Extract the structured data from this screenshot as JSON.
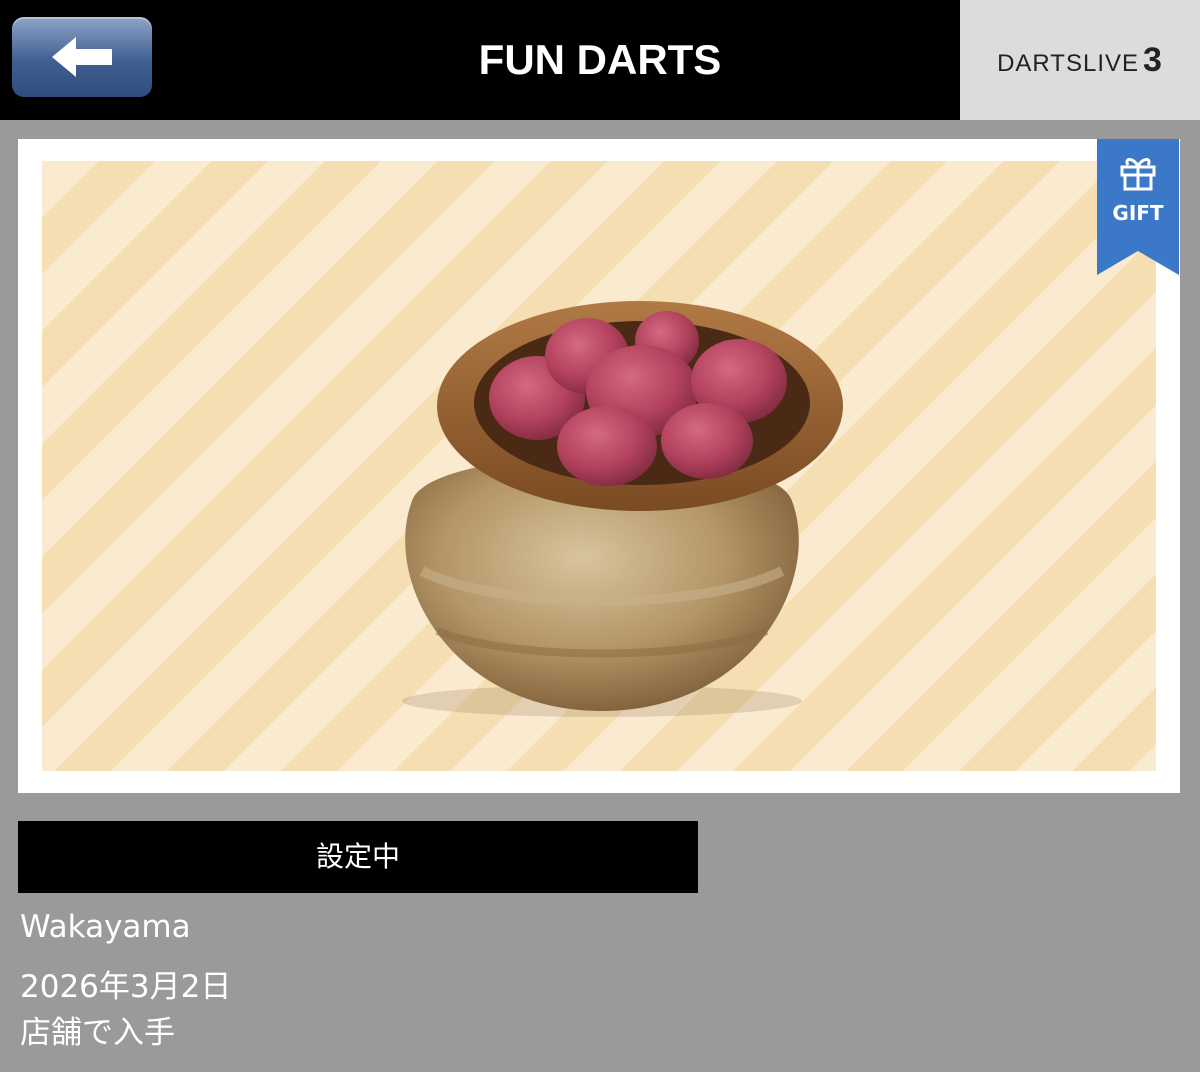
{
  "header": {
    "title": "FUN DARTS",
    "back_icon": "back-arrow-icon",
    "brand": "DARTSLIVE",
    "brand_number": "3"
  },
  "item": {
    "badge": "GIFT",
    "badge_icon": "gift-icon",
    "image": "pot-of-umeboshi"
  },
  "status": {
    "label": "設定中"
  },
  "details": {
    "name": "Wakayama",
    "date": "2026年3月2日",
    "source": "店舗で入手"
  },
  "colors": {
    "header_bg": "#000000",
    "page_bg": "#9a9a9a",
    "gift_badge": "#3b78c8",
    "back_button": "#3f5f92"
  }
}
